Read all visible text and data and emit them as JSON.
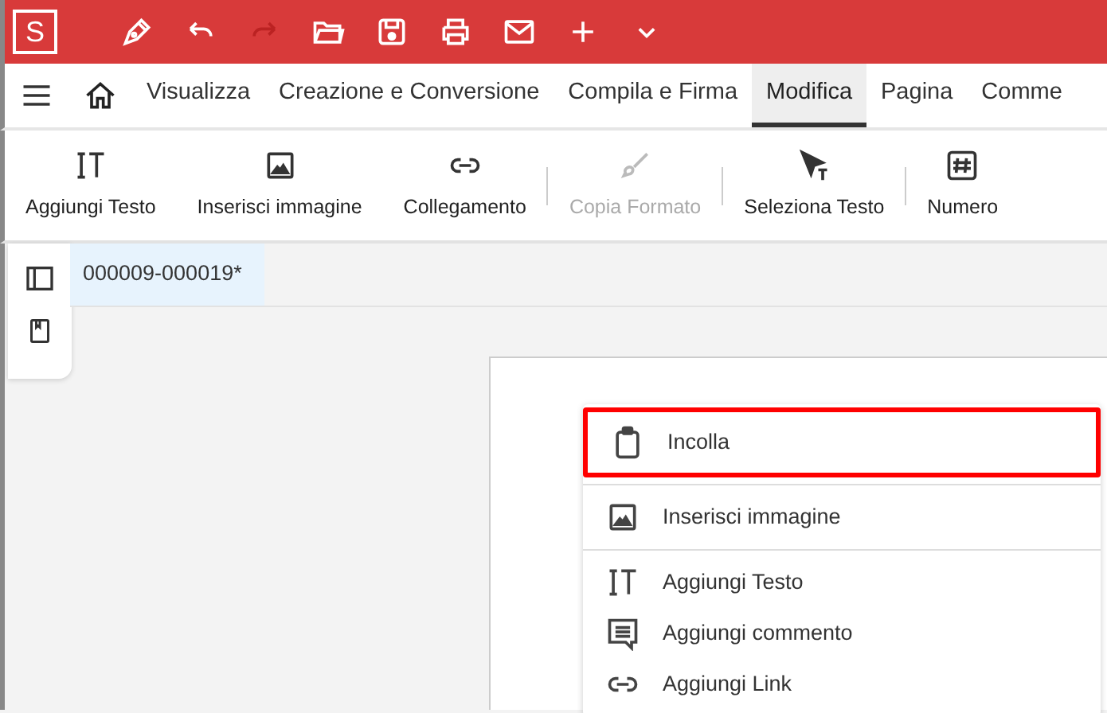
{
  "app": {
    "logo": "S"
  },
  "tabs": [
    {
      "label": "Visualizza",
      "selected": false
    },
    {
      "label": "Creazione e Conversione",
      "selected": false
    },
    {
      "label": "Compila e Firma",
      "selected": false
    },
    {
      "label": "Modifica",
      "selected": true
    },
    {
      "label": "Pagina",
      "selected": false
    },
    {
      "label": "Comme",
      "selected": false
    }
  ],
  "toolbar": [
    {
      "label": "Aggiungi Testo",
      "disabled": false,
      "separator_before": false
    },
    {
      "label": "Inserisci immagine",
      "disabled": false,
      "separator_before": false
    },
    {
      "label": "Collegamento",
      "disabled": false,
      "separator_before": false
    },
    {
      "label": "Copia Formato",
      "disabled": true,
      "separator_before": true
    },
    {
      "label": "Seleziona Testo",
      "disabled": false,
      "separator_before": true
    },
    {
      "label": "Numero",
      "disabled": false,
      "separator_before": true
    }
  ],
  "document_tab": {
    "title": "000009-000019*",
    "selected": true
  },
  "context_menu": {
    "groups": [
      [
        {
          "label": "Incolla",
          "highlighted": true
        }
      ],
      [
        {
          "label": "Inserisci immagine",
          "highlighted": false
        }
      ],
      [
        {
          "label": "Aggiungi Testo",
          "highlighted": false
        },
        {
          "label": "Aggiungi commento",
          "highlighted": false
        },
        {
          "label": "Aggiungi Link",
          "highlighted": false
        }
      ]
    ]
  }
}
